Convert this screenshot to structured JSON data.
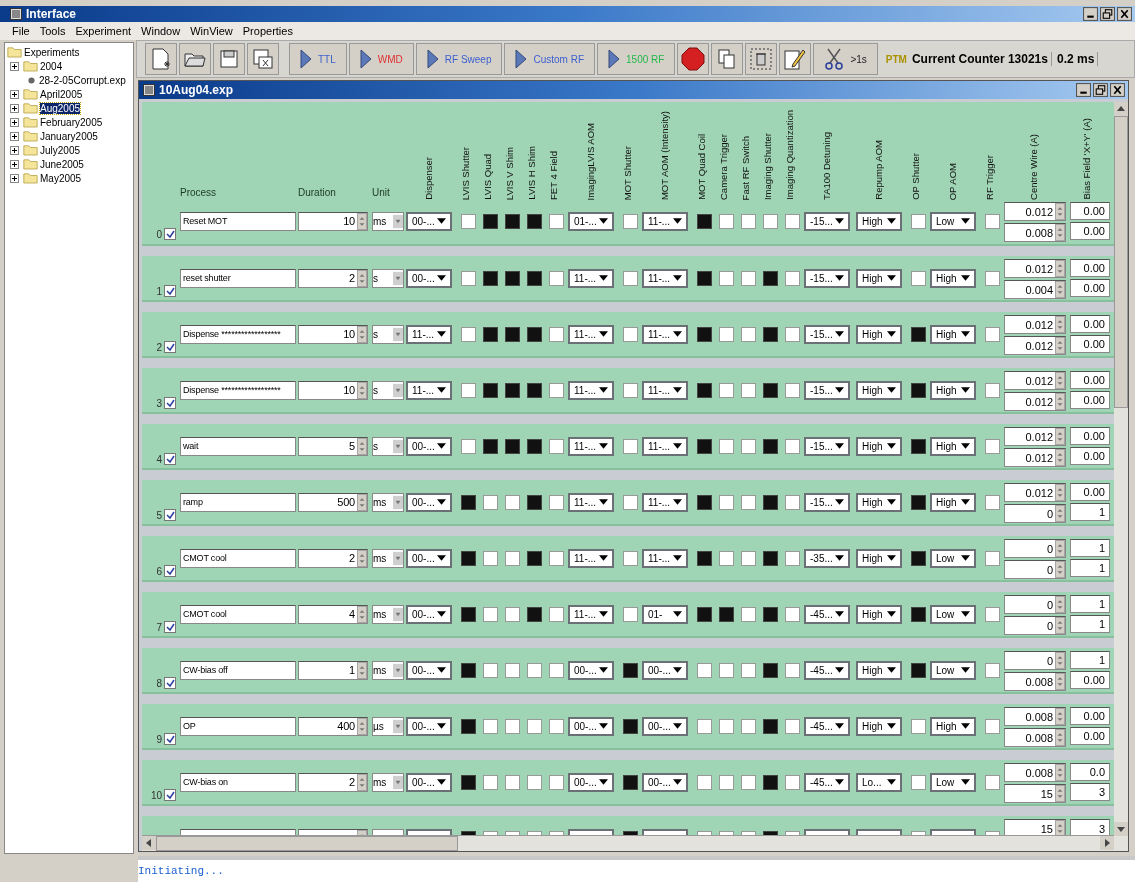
{
  "window": {
    "title": "Interface"
  },
  "menu": [
    "File",
    "Tools",
    "Experiment",
    "Window",
    "WinView",
    "Properties"
  ],
  "tree": {
    "root": "Experiments",
    "items": [
      {
        "label": "2004",
        "kind": "folder",
        "expanded": false,
        "selected": false
      },
      {
        "label": "28-2-05Corrupt.exp",
        "kind": "file",
        "selected": false
      },
      {
        "label": "April2005",
        "kind": "folder",
        "expanded": false,
        "selected": false
      },
      {
        "label": "Aug2005",
        "kind": "folder",
        "expanded": false,
        "selected": true
      },
      {
        "label": "February2005",
        "kind": "folder",
        "expanded": false,
        "selected": false
      },
      {
        "label": "January2005",
        "kind": "folder",
        "expanded": false,
        "selected": false
      },
      {
        "label": "July2005",
        "kind": "folder",
        "expanded": false,
        "selected": false
      },
      {
        "label": "June2005",
        "kind": "folder",
        "expanded": false,
        "selected": false
      },
      {
        "label": "May2005",
        "kind": "folder",
        "expanded": false,
        "selected": false
      }
    ]
  },
  "toolbar": {
    "run_buttons": [
      {
        "label": "TTL",
        "color": "#3a5fcd"
      },
      {
        "label": "WMD",
        "color": "#e03030"
      },
      {
        "label": "RF Sweep",
        "color": "#3a5fcd"
      },
      {
        "label": "Custom RF",
        "color": "#3a5fcd"
      },
      {
        "label": "1500 RF",
        "color": "#22b84a"
      }
    ],
    "cut_label": ">1s",
    "ptm": "PTM",
    "counter": "Current Counter 13021s",
    "interval": "0.2 ms"
  },
  "document": {
    "title": "10Aug04.exp"
  },
  "table": {
    "columns": [
      {
        "label": "Process",
        "kind": "text"
      },
      {
        "label": "Duration",
        "kind": "number"
      },
      {
        "label": "Unit",
        "kind": "unit"
      },
      {
        "label": "Dispenser",
        "kind": "dropdown"
      },
      {
        "label": "LVIS Shutter",
        "kind": "checkbox"
      },
      {
        "label": "LVIS Quad",
        "kind": "checkbox"
      },
      {
        "label": "LVIS V Shim",
        "kind": "checkbox"
      },
      {
        "label": "LVIS H Shim",
        "kind": "checkbox"
      },
      {
        "label": "FET 4 Field",
        "kind": "checkbox"
      },
      {
        "label": "ImagingLVIS AOM",
        "kind": "dropdown"
      },
      {
        "label": "MOT Shutter",
        "kind": "checkbox"
      },
      {
        "label": "MOT AOM (Intensity)",
        "kind": "dropdown"
      },
      {
        "label": "MOT Quad Coil",
        "kind": "checkbox"
      },
      {
        "label": "Camera Trigger",
        "kind": "checkbox"
      },
      {
        "label": "Fast RF Switch",
        "kind": "checkbox"
      },
      {
        "label": "Imaging Shutter",
        "kind": "checkbox"
      },
      {
        "label": "Imaging Quantization",
        "kind": "checkbox"
      },
      {
        "label": "TA100 Detuning",
        "kind": "dropdown"
      },
      {
        "label": "Repump AOM",
        "kind": "dropdown"
      },
      {
        "label": "OP Shutter",
        "kind": "checkbox"
      },
      {
        "label": "OP AOM",
        "kind": "dropdown"
      },
      {
        "label": "RF Trigger",
        "kind": "checkbox"
      },
      {
        "label": "Centre Wire (A)",
        "kind": "spin"
      },
      {
        "label": "Bias Field 'X+Y' (A)",
        "kind": "spin"
      }
    ],
    "rows": [
      {
        "index": "0",
        "enabled": true,
        "cells": [
          "Reset MOT",
          "10",
          "ms",
          "00-...",
          false,
          true,
          true,
          true,
          false,
          "01-...",
          false,
          "11-...",
          true,
          false,
          false,
          false,
          false,
          "-15...",
          "High",
          false,
          "Low",
          false,
          [
            "0.012",
            "0.008"
          ],
          [
            "0.00",
            "0.00"
          ]
        ]
      },
      {
        "index": "1",
        "enabled": true,
        "cells": [
          "reset shutter",
          "2",
          "s",
          "00-...",
          false,
          true,
          true,
          true,
          false,
          "11-...",
          false,
          "11-...",
          true,
          false,
          false,
          true,
          false,
          "-15...",
          "High",
          false,
          "High",
          false,
          [
            "0.012",
            "0.004"
          ],
          [
            "0.00",
            "0.00"
          ]
        ]
      },
      {
        "index": "2",
        "enabled": true,
        "cells": [
          "Dispense ******************",
          "10",
          "s",
          "11-...",
          false,
          true,
          true,
          true,
          false,
          "11-...",
          false,
          "11-...",
          true,
          false,
          false,
          true,
          false,
          "-15...",
          "High",
          true,
          "High",
          false,
          [
            "0.012",
            "0.012"
          ],
          [
            "0.00",
            "0.00"
          ]
        ]
      },
      {
        "index": "3",
        "enabled": true,
        "cells": [
          "Dispense ******************",
          "10",
          "s",
          "11-...",
          false,
          true,
          true,
          true,
          false,
          "11-...",
          false,
          "11-...",
          true,
          false,
          false,
          true,
          false,
          "-15...",
          "High",
          true,
          "High",
          false,
          [
            "0.012",
            "0.012"
          ],
          [
            "0.00",
            "0.00"
          ]
        ]
      },
      {
        "index": "4",
        "enabled": true,
        "cells": [
          "wait",
          "5",
          "s",
          "00-...",
          false,
          true,
          true,
          true,
          false,
          "11-...",
          false,
          "11-...",
          true,
          false,
          false,
          true,
          false,
          "-15...",
          "High",
          true,
          "High",
          false,
          [
            "0.012",
            "0.012"
          ],
          [
            "0.00",
            "0.00"
          ]
        ]
      },
      {
        "index": "5",
        "enabled": true,
        "cells": [
          "ramp",
          "500",
          "ms",
          "00-...",
          true,
          false,
          false,
          true,
          false,
          "11-...",
          false,
          "11-...",
          true,
          false,
          false,
          true,
          false,
          "-15...",
          "High",
          true,
          "High",
          false,
          [
            "0.012",
            "0"
          ],
          [
            "0.00",
            "1"
          ]
        ]
      },
      {
        "index": "6",
        "enabled": true,
        "cells": [
          "CMOT cool",
          "2",
          "ms",
          "00-...",
          true,
          false,
          false,
          true,
          false,
          "11-...",
          false,
          "11-...",
          true,
          false,
          false,
          true,
          false,
          "-35...",
          "High",
          true,
          "Low",
          false,
          [
            "0",
            "0"
          ],
          [
            "1",
            "1"
          ]
        ]
      },
      {
        "index": "7",
        "enabled": true,
        "cells": [
          "CMOT cool",
          "4",
          "ms",
          "00-...",
          true,
          false,
          false,
          true,
          false,
          "11-...",
          false,
          "01-",
          true,
          true,
          false,
          true,
          false,
          "-45...",
          "High",
          true,
          "Low",
          false,
          [
            "0",
            "0"
          ],
          [
            "1",
            "1"
          ]
        ]
      },
      {
        "index": "8",
        "enabled": true,
        "cells": [
          "CW-bias off",
          "1",
          "ms",
          "00-...",
          true,
          false,
          false,
          false,
          false,
          "00-...",
          true,
          "00-...",
          false,
          false,
          false,
          true,
          false,
          "-45...",
          "High",
          true,
          "Low",
          false,
          [
            "0",
            "0.008"
          ],
          [
            "1",
            "0.00"
          ]
        ]
      },
      {
        "index": "9",
        "enabled": true,
        "cells": [
          "OP",
          "400",
          "µs",
          "00-...",
          true,
          false,
          false,
          false,
          false,
          "00-...",
          true,
          "00-...",
          false,
          false,
          false,
          true,
          false,
          "-45...",
          "High",
          false,
          "High",
          false,
          [
            "0.008",
            "0.008"
          ],
          [
            "0.00",
            "0.00"
          ]
        ]
      },
      {
        "index": "10",
        "enabled": true,
        "cells": [
          "CW-bias on",
          "2",
          "ms",
          "00-...",
          true,
          false,
          false,
          false,
          false,
          "00-...",
          true,
          "00-...",
          false,
          false,
          false,
          true,
          false,
          "-45...",
          "Lo...",
          false,
          "Low",
          false,
          [
            "0.008",
            "15"
          ],
          [
            "0.0",
            "3"
          ]
        ]
      },
      {
        "cells": [
          null,
          null,
          null,
          null,
          true,
          false,
          false,
          false,
          false,
          null,
          true,
          null,
          false,
          false,
          false,
          true,
          false,
          null,
          null,
          false,
          null,
          false,
          [
            "15"
          ],
          [
            "3"
          ]
        ]
      }
    ]
  },
  "log": "Initiating..."
}
